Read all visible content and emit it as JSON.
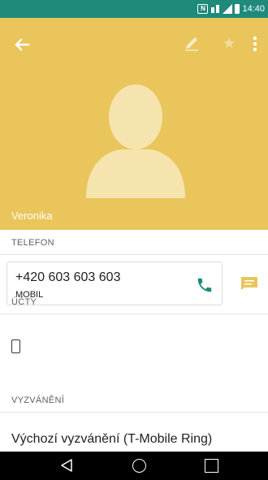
{
  "status_bar": {
    "time": "14:40",
    "icons": [
      "nfc-icon",
      "dual-sim-icon",
      "signal-icon",
      "battery-icon"
    ]
  },
  "header": {
    "contact_name": "Veronika",
    "background_color": "#e9c55b",
    "actions": [
      "back-arrow-icon",
      "edit-pencil-icon",
      "star-icon",
      "more-vert-icon"
    ]
  },
  "phone_section": {
    "title": "TELEFON",
    "entries": [
      {
        "number": "+420 603 603 603",
        "type": "MOBIL"
      }
    ]
  },
  "accounts_section": {
    "title": "ÚČTY",
    "icon": "phone-device-icon"
  },
  "ringtone_section": {
    "title": "VYZVÁNĚNÍ",
    "value": "Výchozí vyzvánění (T-Mobile Ring)"
  },
  "navigation": [
    "nav-back-icon",
    "nav-home-icon",
    "nav-recents-icon"
  ],
  "colors": {
    "status_bar": "#1f8a7a",
    "accent": "#1f8a7a",
    "message": "#e9c55b"
  }
}
